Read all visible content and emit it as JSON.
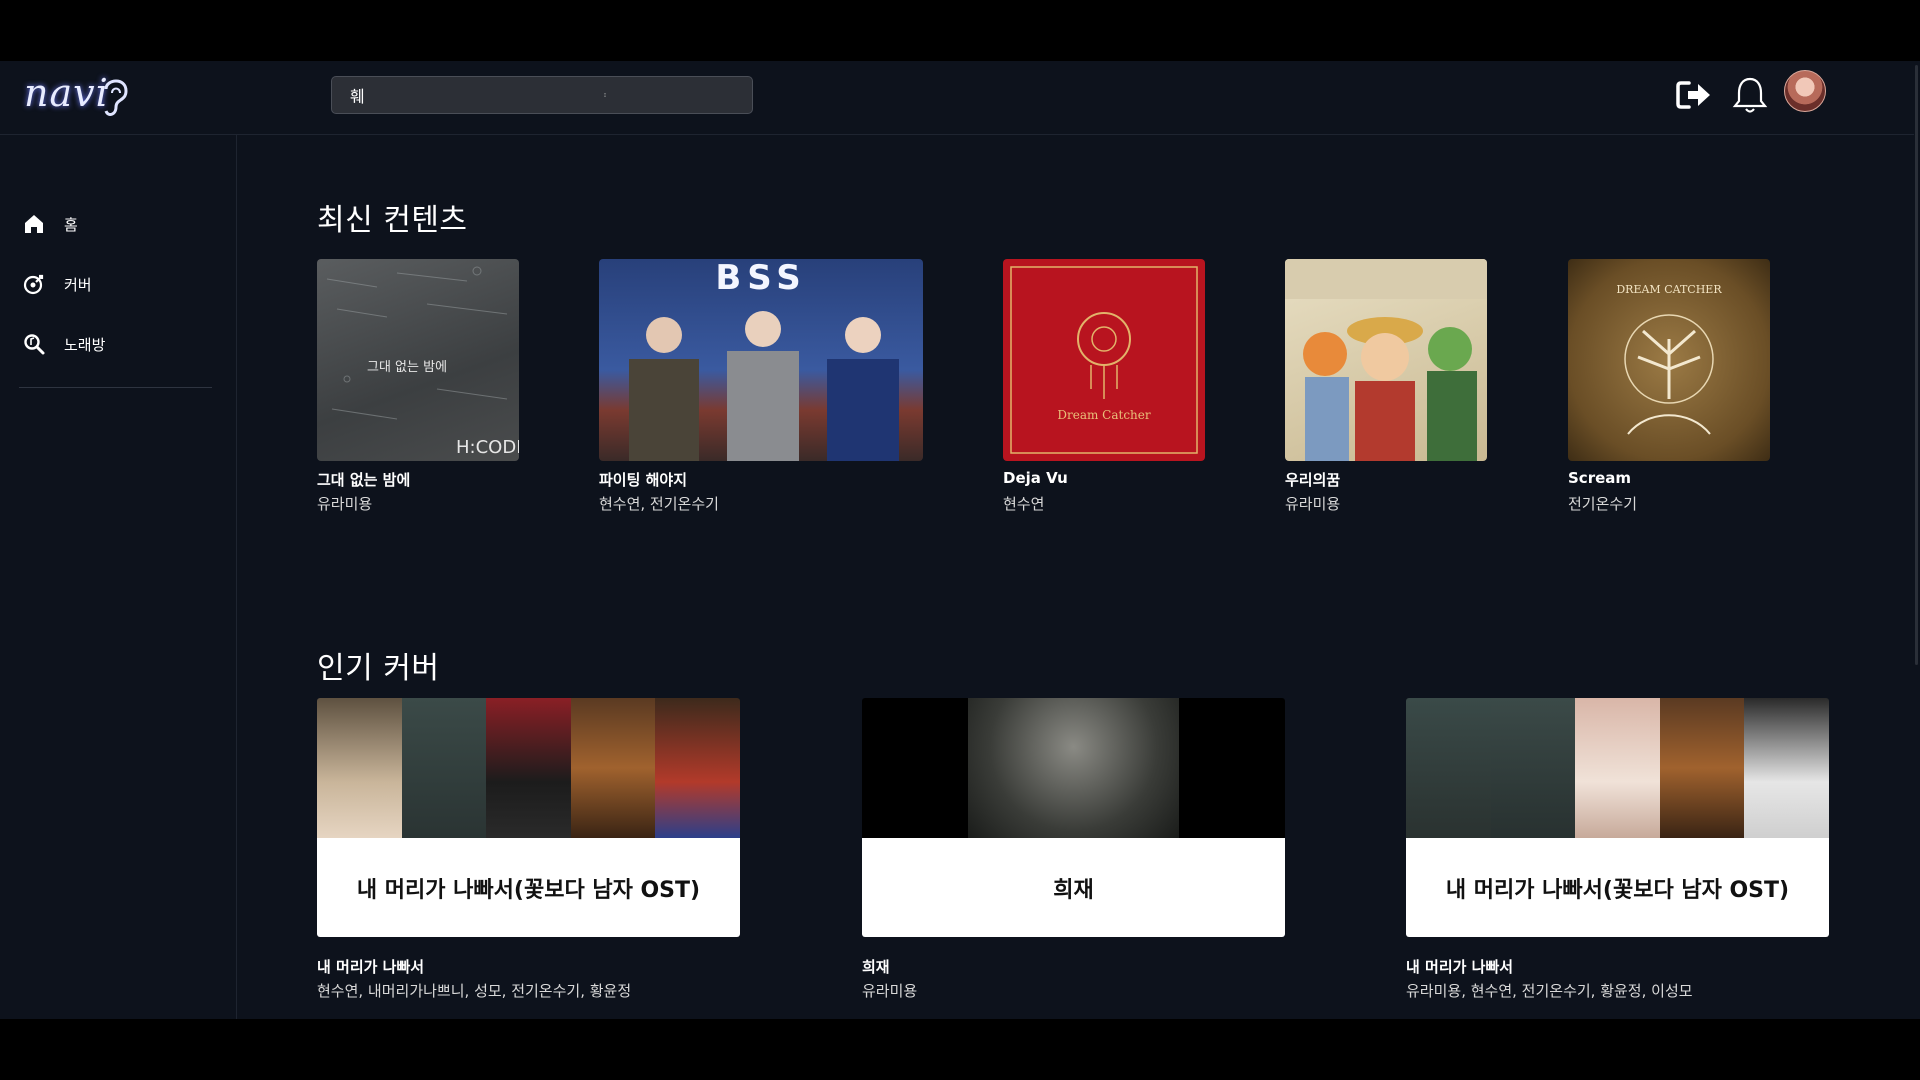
{
  "app": {
    "logo_text": "navi"
  },
  "search": {
    "value": "훼",
    "placeholder": ""
  },
  "header": {
    "logout_icon": "logout-icon",
    "bell_icon": "bell-icon",
    "avatar_icon": "avatar"
  },
  "sidebar": {
    "items": [
      {
        "label": "홈",
        "icon": "home-icon"
      },
      {
        "label": "커버",
        "icon": "cover-icon"
      },
      {
        "label": "노래방",
        "icon": "search-music-icon"
      }
    ]
  },
  "latest": {
    "title": "최신 컨텐츠",
    "items": [
      {
        "title": "그대 없는 밤에",
        "artist": "유라미용",
        "cover_text": "그대 없는 밤에",
        "cover_brand": "H:CODE"
      },
      {
        "title": "파이팅 해야지",
        "artist": "현수연, 전기온수기",
        "cover_text": "BSS"
      },
      {
        "title": "Deja Vu",
        "artist": "현수연",
        "cover_text": "Dream Catcher"
      },
      {
        "title": "우리의꿈",
        "artist": "유라미용",
        "cover_text": ""
      },
      {
        "title": "Scream",
        "artist": "전기온수기",
        "cover_text": "DREAM CATCHER"
      }
    ]
  },
  "popular": {
    "title": "인기 커버",
    "items": [
      {
        "banner": "내 머리가 나빠서(꽃보다 남자 OST)",
        "title": "내 머리가 나빠서",
        "artists": "현수연, 내머리가나쁘니, 성모, 전기온수기, 황윤정"
      },
      {
        "banner": "희재",
        "title": "희재",
        "artists": "유라미용"
      },
      {
        "banner": "내 머리가 나빠서(꽃보다 남자 OST)",
        "title": "내 머리가 나빠서",
        "artists": "유라미용, 현수연, 전기온수기, 황윤정, 이성모"
      }
    ]
  },
  "colors": {
    "background": "#0d121c",
    "frame": "#000000",
    "deja_vu_cover": "#b8141f",
    "scream_cover": "#7a5a2c"
  }
}
